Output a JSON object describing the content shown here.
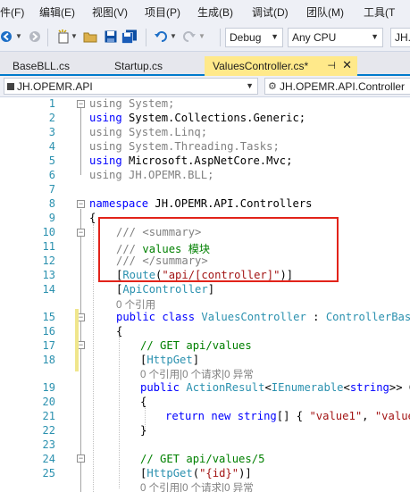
{
  "menu": {
    "items": [
      "件(F)",
      "编辑(E)",
      "视图(V)",
      "项目(P)",
      "生成(B)",
      "调试(D)",
      "团队(M)",
      "工具(T"
    ]
  },
  "toolbar": {
    "config": "Debug",
    "platform": "Any CPU",
    "startup": "JH."
  },
  "tabs": [
    {
      "label": "BaseBLL.cs"
    },
    {
      "label": "Startup.cs"
    },
    {
      "label": "ValuesController.cs*"
    }
  ],
  "navbar": {
    "project": "JH.OPEMR.API",
    "class": "JH.OPEMR.API.Controller"
  },
  "code": {
    "lines": [
      "1",
      "2",
      "3",
      "4",
      "5",
      "6",
      "7",
      "8",
      "9",
      "10",
      "11",
      "12",
      "13",
      "14",
      "15",
      "16",
      "17",
      "18",
      "19",
      "20",
      "21",
      "22",
      "23",
      "24",
      "25"
    ],
    "l1_kw": "using",
    "l1_ns": "System;",
    "l2_kw": "using",
    "l2_ns": "System.Collections.Generic;",
    "l3_kw": "using",
    "l3_ns": "System.Linq;",
    "l4_kw": "using",
    "l4_ns": "System.Threading.Tasks;",
    "l5_kw": "using",
    "l5_ns": "Microsoft.AspNetCore.Mvc;",
    "l6_kw": "using",
    "l6_ns": "JH.OPEMR.BLL;",
    "l8_kw": "namespace",
    "l8_ns": "JH.OPEMR.API.Controllers",
    "l9": "{",
    "l10_prefix": "///",
    "l10_tag": "<summary>",
    "l11_prefix": "///",
    "l11_text": "values 模块",
    "l12_prefix": "///",
    "l12_tag": "</summary>",
    "l13_a": "[",
    "l13_attr": "Route",
    "l13_b": "(",
    "l13_str": "\"api/[controller]\"",
    "l13_c": ")]",
    "l14_a": "[",
    "l14_attr": "ApiController",
    "l14_b": "]",
    "lens1": "0 个引用",
    "l15_kw1": "public",
    "l15_kw2": "class",
    "l15_cls": "ValuesController",
    "l15_colon": ":",
    "l15_base": "ControllerBase",
    "l16": "{",
    "l17": "// GET api/values",
    "l18_a": "[",
    "l18_attr": "HttpGet",
    "l18_b": "]",
    "lens2": "0 个引用|0 个请求|0 异常",
    "l19_kw": "public",
    "l19_t1": "ActionResult",
    "l19_lt": "<",
    "l19_t2": "IEnumerable",
    "l19_lt2": "<",
    "l19_kw2": "string",
    "l19_rest": ">> Ge",
    "l20": "{",
    "l21_kw1": "return",
    "l21_kw2": "new",
    "l21_kw3": "string",
    "l21_mid": "[] { ",
    "l21_s1": "\"value1\"",
    "l21_comma": ", ",
    "l21_s2": "\"value2\"",
    "l22": "}",
    "l24": "// GET api/values/5",
    "l25_a": "[",
    "l25_attr": "HttpGet",
    "l25_b": "(",
    "l25_str": "\"{id}\"",
    "l25_c": ")]",
    "lens3": "0 个引用|0 个请求|0 异常"
  },
  "colors": {
    "keyword": "#0000ff",
    "type": "#2b91af",
    "string": "#a31515",
    "comment": "#008000",
    "highlight_box": "#e2231a",
    "active_tab": "#ffe98a"
  }
}
